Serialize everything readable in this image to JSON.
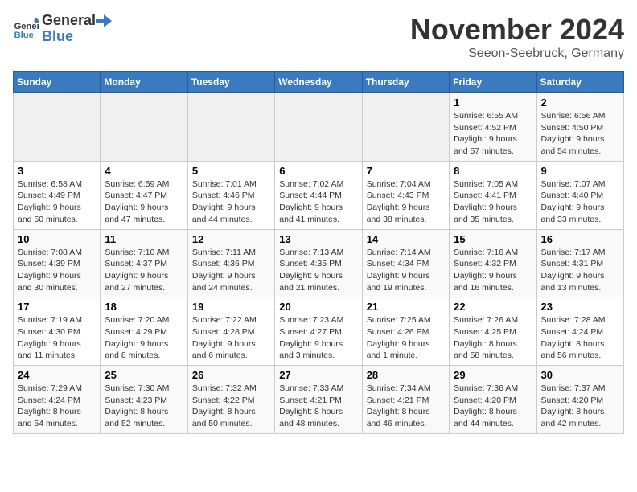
{
  "logo": {
    "general": "General",
    "blue": "Blue"
  },
  "header": {
    "month": "November 2024",
    "location": "Seeon-Seebruck, Germany"
  },
  "weekdays": [
    "Sunday",
    "Monday",
    "Tuesday",
    "Wednesday",
    "Thursday",
    "Friday",
    "Saturday"
  ],
  "weeks": [
    [
      {
        "day": "",
        "info": ""
      },
      {
        "day": "",
        "info": ""
      },
      {
        "day": "",
        "info": ""
      },
      {
        "day": "",
        "info": ""
      },
      {
        "day": "",
        "info": ""
      },
      {
        "day": "1",
        "info": "Sunrise: 6:55 AM\nSunset: 4:52 PM\nDaylight: 9 hours and 57 minutes."
      },
      {
        "day": "2",
        "info": "Sunrise: 6:56 AM\nSunset: 4:50 PM\nDaylight: 9 hours and 54 minutes."
      }
    ],
    [
      {
        "day": "3",
        "info": "Sunrise: 6:58 AM\nSunset: 4:49 PM\nDaylight: 9 hours and 50 minutes."
      },
      {
        "day": "4",
        "info": "Sunrise: 6:59 AM\nSunset: 4:47 PM\nDaylight: 9 hours and 47 minutes."
      },
      {
        "day": "5",
        "info": "Sunrise: 7:01 AM\nSunset: 4:46 PM\nDaylight: 9 hours and 44 minutes."
      },
      {
        "day": "6",
        "info": "Sunrise: 7:02 AM\nSunset: 4:44 PM\nDaylight: 9 hours and 41 minutes."
      },
      {
        "day": "7",
        "info": "Sunrise: 7:04 AM\nSunset: 4:43 PM\nDaylight: 9 hours and 38 minutes."
      },
      {
        "day": "8",
        "info": "Sunrise: 7:05 AM\nSunset: 4:41 PM\nDaylight: 9 hours and 35 minutes."
      },
      {
        "day": "9",
        "info": "Sunrise: 7:07 AM\nSunset: 4:40 PM\nDaylight: 9 hours and 33 minutes."
      }
    ],
    [
      {
        "day": "10",
        "info": "Sunrise: 7:08 AM\nSunset: 4:39 PM\nDaylight: 9 hours and 30 minutes."
      },
      {
        "day": "11",
        "info": "Sunrise: 7:10 AM\nSunset: 4:37 PM\nDaylight: 9 hours and 27 minutes."
      },
      {
        "day": "12",
        "info": "Sunrise: 7:11 AM\nSunset: 4:36 PM\nDaylight: 9 hours and 24 minutes."
      },
      {
        "day": "13",
        "info": "Sunrise: 7:13 AM\nSunset: 4:35 PM\nDaylight: 9 hours and 21 minutes."
      },
      {
        "day": "14",
        "info": "Sunrise: 7:14 AM\nSunset: 4:34 PM\nDaylight: 9 hours and 19 minutes."
      },
      {
        "day": "15",
        "info": "Sunrise: 7:16 AM\nSunset: 4:32 PM\nDaylight: 9 hours and 16 minutes."
      },
      {
        "day": "16",
        "info": "Sunrise: 7:17 AM\nSunset: 4:31 PM\nDaylight: 9 hours and 13 minutes."
      }
    ],
    [
      {
        "day": "17",
        "info": "Sunrise: 7:19 AM\nSunset: 4:30 PM\nDaylight: 9 hours and 11 minutes."
      },
      {
        "day": "18",
        "info": "Sunrise: 7:20 AM\nSunset: 4:29 PM\nDaylight: 9 hours and 8 minutes."
      },
      {
        "day": "19",
        "info": "Sunrise: 7:22 AM\nSunset: 4:28 PM\nDaylight: 9 hours and 6 minutes."
      },
      {
        "day": "20",
        "info": "Sunrise: 7:23 AM\nSunset: 4:27 PM\nDaylight: 9 hours and 3 minutes."
      },
      {
        "day": "21",
        "info": "Sunrise: 7:25 AM\nSunset: 4:26 PM\nDaylight: 9 hours and 1 minute."
      },
      {
        "day": "22",
        "info": "Sunrise: 7:26 AM\nSunset: 4:25 PM\nDaylight: 8 hours and 58 minutes."
      },
      {
        "day": "23",
        "info": "Sunrise: 7:28 AM\nSunset: 4:24 PM\nDaylight: 8 hours and 56 minutes."
      }
    ],
    [
      {
        "day": "24",
        "info": "Sunrise: 7:29 AM\nSunset: 4:24 PM\nDaylight: 8 hours and 54 minutes."
      },
      {
        "day": "25",
        "info": "Sunrise: 7:30 AM\nSunset: 4:23 PM\nDaylight: 8 hours and 52 minutes."
      },
      {
        "day": "26",
        "info": "Sunrise: 7:32 AM\nSunset: 4:22 PM\nDaylight: 8 hours and 50 minutes."
      },
      {
        "day": "27",
        "info": "Sunrise: 7:33 AM\nSunset: 4:21 PM\nDaylight: 8 hours and 48 minutes."
      },
      {
        "day": "28",
        "info": "Sunrise: 7:34 AM\nSunset: 4:21 PM\nDaylight: 8 hours and 46 minutes."
      },
      {
        "day": "29",
        "info": "Sunrise: 7:36 AM\nSunset: 4:20 PM\nDaylight: 8 hours and 44 minutes."
      },
      {
        "day": "30",
        "info": "Sunrise: 7:37 AM\nSunset: 4:20 PM\nDaylight: 8 hours and 42 minutes."
      }
    ]
  ]
}
